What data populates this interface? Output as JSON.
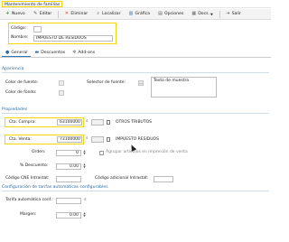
{
  "window": {
    "title": "Mantenimiento de familias"
  },
  "toolbar": {
    "nuevo": "Nuevo",
    "editar": "Editar",
    "eliminar": "Eliminar",
    "localizar": "Localizar",
    "grafica": "Gráfica",
    "opciones": "Opciones",
    "docs": "Docs.",
    "salir": "Salir"
  },
  "header": {
    "codigo_label": "Código:",
    "codigo_value": "",
    "nombre_label": "Nombre:",
    "nombre_value": "IMPUESTO DE RESIDUOS"
  },
  "tabs": [
    {
      "label": "General"
    },
    {
      "label": "Descuentos"
    },
    {
      "label": "Add-ons"
    }
  ],
  "apariencia": {
    "title": "Apariencia",
    "color_fuente": "Color de fuente:",
    "selector_fuente": "Selector de fuente:",
    "texto_muestra": "Texto de muestra",
    "color_fondo": "Color de fondo:"
  },
  "propiedades": {
    "title": "Propiedades",
    "cta_compra_label": "Cta. Compra:",
    "cta_compra_value": "63100000",
    "cta_compra_desc": "OTROS TRIBUTOS",
    "cta_venta_label": "Cta. Venta:",
    "cta_venta_value": "73100000",
    "cta_venta_desc": "IMPUESTO RESIDUOS",
    "orden_label": "Orden:",
    "orden_value": "0",
    "agrupar_label": "Agrupar artículos en impresión de venta",
    "descuento_label": "% Descuento:",
    "descuento_value": "0.00",
    "cne_label": "Código CNE Intrastat:",
    "adicional_label": "Código adicional Intrastat:"
  },
  "tarifas": {
    "title": "Configuración de tarifas automáticas configurables",
    "tarifa_label": "Tarifa automática conf.:",
    "margen_label": "Margen:",
    "margen_value": "0.00"
  }
}
